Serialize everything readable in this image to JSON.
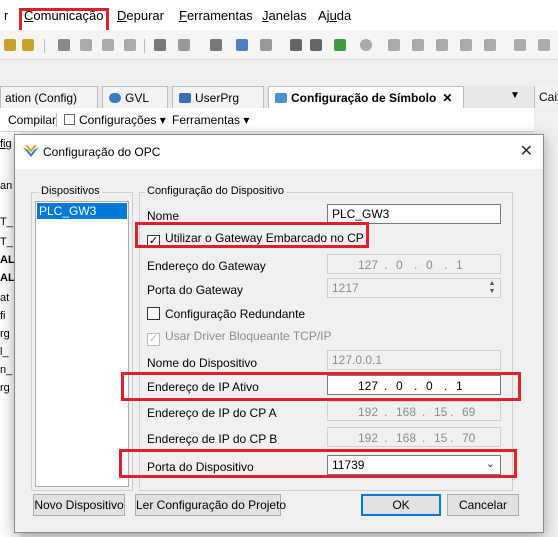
{
  "menubar": {
    "items": [
      {
        "label": "Comunicação",
        "underline": "C",
        "rest": "omunicação"
      },
      {
        "label": "Depurar",
        "underline": "D",
        "rest": "epurar"
      },
      {
        "label": "Ferramentas",
        "underline": "F",
        "rest": "erramentas"
      },
      {
        "label": "Janelas",
        "underline": "J",
        "rest": "anelas"
      },
      {
        "label": "Ajuda",
        "underline": "u",
        "pre": "Aj",
        "rest": "da"
      }
    ],
    "partial_left": "r"
  },
  "tabs": [
    {
      "label": "ation (Config)"
    },
    {
      "label": "GVL"
    },
    {
      "label": "UserPrg"
    },
    {
      "label": "Configuração de Símbolo"
    }
  ],
  "right_panel_tab": "Caix",
  "doc_toolbar": {
    "compile": "Compilar",
    "settings": "Configurações",
    "tools": "Ferramentas"
  },
  "side_fragments": [
    "fig",
    "an",
    "T_",
    "T_",
    "AL",
    "AL",
    "at",
    "fi",
    "rg",
    "l_",
    "n_",
    "rg"
  ],
  "dialog": {
    "title": "Configuração do OPC",
    "devices_legend": "Dispositivos",
    "devices": [
      "PLC_GW3"
    ],
    "config_legend": "Configuração do Dispositivo",
    "name_label": "Nome",
    "name_value": "PLC_GW3",
    "use_gateway_label": "Utilizar o Gateway Embarcado no CP",
    "use_gateway_checked": true,
    "gateway_address_label": "Endereço do Gateway",
    "gateway_address": [
      "127",
      "0",
      "0",
      "1"
    ],
    "gateway_port_label": "Porta do Gateway",
    "gateway_port": "1217",
    "redundant_label": "Configuração Redundante",
    "redundant_checked": false,
    "blocking_driver_label": "Usar Driver Bloqueante TCP/IP",
    "blocking_driver_checked": true,
    "device_name_label": "Nome do Dispositivo",
    "device_name": "127.0.0.1",
    "active_ip_label": "Endereço de IP Ativo",
    "active_ip": [
      "127",
      "0",
      "0",
      "1"
    ],
    "ip_a_label": "Endereço de IP do CP A",
    "ip_a": [
      "192",
      "168",
      "15",
      "69"
    ],
    "ip_b_label": "Endereço de IP do CP B",
    "ip_b": [
      "192",
      "168",
      "15",
      "70"
    ],
    "device_port_label": "Porta do Dispositivo",
    "device_port": "11739",
    "new_device_button": "Novo Dispositivo",
    "read_config_button": "Ler Configuração do Projeto",
    "ok_button": "OK",
    "cancel_button": "Cancelar"
  },
  "colors": {
    "highlight": "#e0202a",
    "selection": "#0078d7"
  }
}
